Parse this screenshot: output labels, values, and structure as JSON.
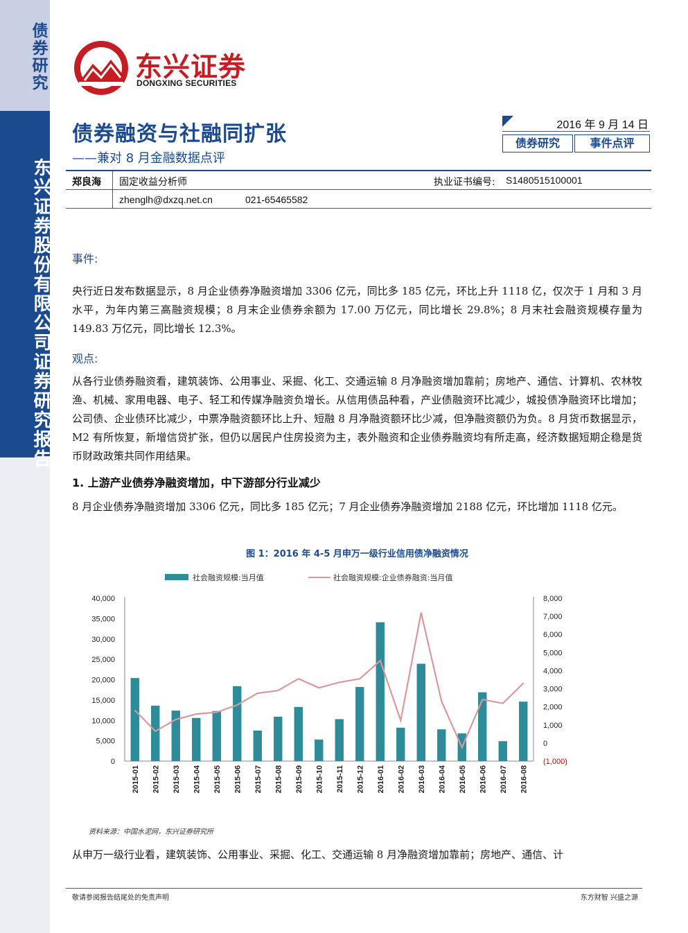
{
  "sidebar": {
    "top_label": "债券研究",
    "main_label": "东兴证券股份有限公司证券研究报告"
  },
  "logo": {
    "cn": "东兴证券",
    "en": "DONGXING SECURITIES"
  },
  "header": {
    "title": "债券融资与社融同扩张",
    "subtitle": "——兼对 8 月金融数据点评",
    "date": "2016 年 9 月 14 日",
    "tags": [
      "债券研究",
      "事件点评"
    ]
  },
  "analyst": {
    "name": "郑良海",
    "role": "固定收益分析师",
    "cert_label": "执业证书编号:",
    "cert_no": "S1480515100001",
    "email": "zhenglh@dxzq.net.cn",
    "phone": "021-65465582"
  },
  "body": {
    "event_heading": "事件:",
    "event_text": "央行近日发布数据显示，8 月企业债券净融资增加 3306 亿元，同比多 185 亿元，环比上升 1118 亿，仅次于 1 月和 3 月水平，为年内第三高融资规模；8 月末企业债券余额为 17.00 万亿元，同比增长 29.8%；8 月末社会融资规模存量为 149.83 万亿元，同比增长 12.3%。",
    "view_heading": "观点:",
    "view_text": "从各行业债券融资看，建筑装饰、公用事业、采掘、化工、交通运输 8 月净融资增加靠前；房地产、通信、计算机、农林牧渔、机械、家用电器、电子、轻工和传媒净融资负增长。从信用债品种看，产业债融资环比减少，城投债净融资环比增加；公司债、企业债环比减少，中票净融资额环比上升、短融 8 月净融资额环比少减，但净融资额仍为负。8 月货币数据显示，M2 有所恢复，新增信贷扩张，但仍以居民户住房投资为主，表外融资和企业债券融资均有所走高，经济数据短期企稳是货币财政政策共同作用结果。",
    "section1_title": "1. 上游产业债券净融资增加，中下游部分行业减少",
    "section1_text": "8 月企业债券净融资增加 3306 亿元，同比多 185 亿元；7 月企业债券净融资增加 2188 亿元，环比增加 1118 亿元。",
    "after_chart_text": "从申万一级行业看，建筑装饰、公用事业、采掘、化工、交通运输 8 月净融资增加靠前；房地产、通信、计"
  },
  "chart": {
    "title": "图 1：2016 年 4-5 月申万一级行业信用债净融资情况",
    "source": "资料来源：中国水泥网，东兴证券研究所"
  },
  "chart_data": {
    "type": "bar",
    "title": "图 1：2016 年 4-5 月申万一级行业信用债净融资情况",
    "categories": [
      "2015-01",
      "2015-02",
      "2015-03",
      "2015-04",
      "2015-05",
      "2015-06",
      "2015-07",
      "2015-08",
      "2015-09",
      "2015-10",
      "2015-11",
      "2015-12",
      "2016-01",
      "2016-02",
      "2016-03",
      "2016-04",
      "2016-05",
      "2016-06",
      "2016-07",
      "2016-08"
    ],
    "series": [
      {
        "name": "社会融资规模:当月值",
        "type": "bar",
        "axis": "left",
        "values": [
          20400,
          13600,
          12400,
          10600,
          12300,
          18400,
          7500,
          10900,
          13300,
          5300,
          10300,
          18200,
          34100,
          8200,
          23900,
          7800,
          6800,
          16900,
          4900,
          14600
        ]
      },
      {
        "name": "社会融资规模:企业债券融资:当月值",
        "type": "line",
        "axis": "right",
        "values": [
          1800,
          650,
          1300,
          1600,
          1700,
          2100,
          2750,
          2900,
          3550,
          3050,
          3350,
          3550,
          4550,
          1250,
          7200,
          2300,
          -250,
          2400,
          2190,
          3306
        ]
      }
    ],
    "left_axis": {
      "min": 0,
      "max": 40000,
      "ticks": [
        "0",
        "5,000",
        "10,000",
        "15,000",
        "20,000",
        "25,000",
        "30,000",
        "35,000",
        "40,000"
      ]
    },
    "right_axis": {
      "min": -1000,
      "max": 8000,
      "ticks": [
        "(1,000)",
        "0",
        "1,000",
        "2,000",
        "3,000",
        "4,000",
        "5,000",
        "6,000",
        "7,000",
        "8,000"
      ]
    },
    "legend_position": "top",
    "grid": false,
    "colors": {
      "bar": "#2e8b9a",
      "line": "#d9999a",
      "negative_tick": "#c00000"
    }
  },
  "footer": {
    "left": "敬请参阅报告结尾处的免责声明",
    "right": "东方财智  兴盛之源"
  }
}
